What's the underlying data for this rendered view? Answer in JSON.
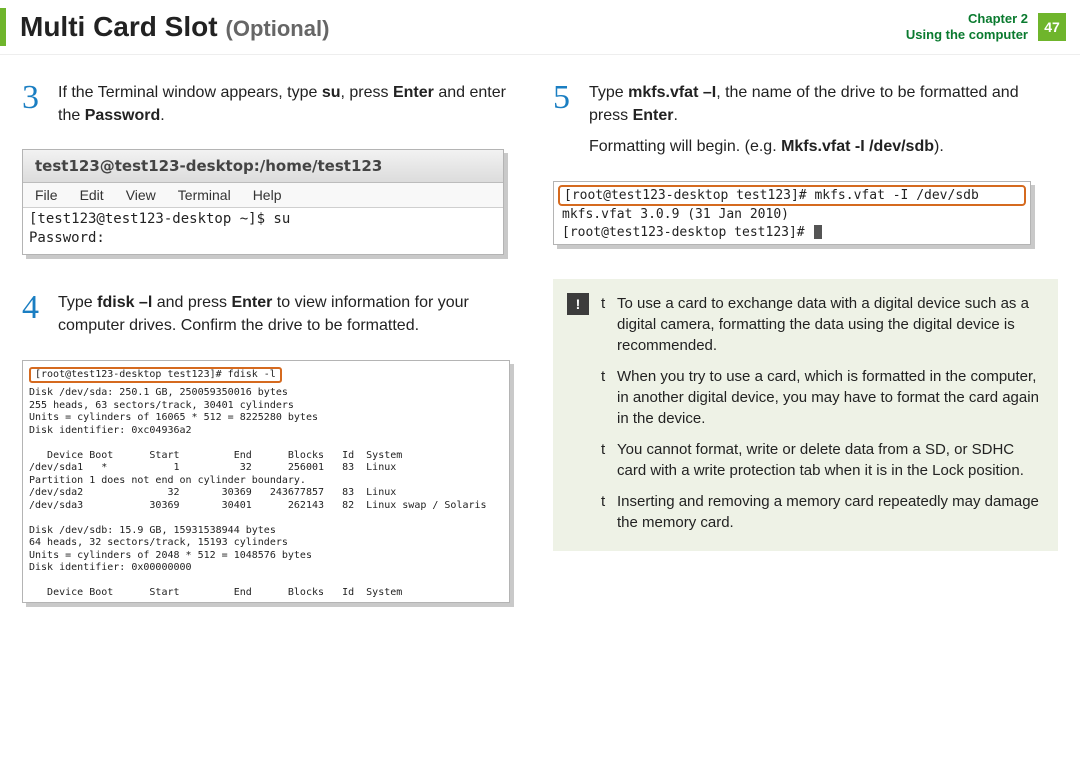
{
  "header": {
    "title_main": "Multi Card Slot",
    "title_sub": "(Optional)",
    "chapter_line1": "Chapter 2",
    "chapter_line2": "Using the computer",
    "page_num": "47"
  },
  "step3": {
    "num": "3",
    "text_parts": [
      "If the Terminal window appears, type ",
      "su",
      ", press ",
      "Enter",
      " and enter the ",
      "Password",
      "."
    ],
    "term_title": "test123@test123-desktop:/home/test123",
    "menu": [
      "File",
      "Edit",
      "View",
      "Terminal",
      "Help"
    ],
    "content": "[test123@test123-desktop ~]$ su\nPassword:"
  },
  "step4": {
    "num": "4",
    "text_parts": [
      "Type ",
      "fdisk –l",
      " and press ",
      "Enter",
      " to view information for your computer drives. Confirm the drive to be formatted."
    ],
    "prompt": "[root@test123-desktop test123]# fdisk -l",
    "body": "Disk /dev/sda: 250.1 GB, 250059350016 bytes\n255 heads, 63 sectors/track, 30401 cylinders\nUnits = cylinders of 16065 * 512 = 8225280 bytes\nDisk identifier: 0xc04936a2\n\n   Device Boot      Start         End      Blocks   Id  System\n/dev/sda1   *           1          32      256001   83  Linux\nPartition 1 does not end on cylinder boundary.\n/dev/sda2              32       30369   243677857   83  Linux\n/dev/sda3           30369       30401      262143   82  Linux swap / Solaris\n\nDisk /dev/sdb: 15.9 GB, 15931538944 bytes\n64 heads, 32 sectors/track, 15193 cylinders\nUnits = cylinders of 2048 * 512 = 1048576 bytes\nDisk identifier: 0x00000000\n\n   Device Boot      Start         End      Blocks   Id  System"
  },
  "step5": {
    "num": "5",
    "text_parts": [
      "Type ",
      "mkfs.vfat –I",
      ", the name of the drive to be formatted and press ",
      "Enter",
      "."
    ],
    "line2_parts": [
      "Formatting will begin. (e.g. ",
      "Mkfs.vfat -I /dev/sdb",
      ")."
    ],
    "line1": "[root@test123-desktop test123]# mkfs.vfat -I /dev/sdb",
    "rest": "mkfs.vfat 3.0.9 (31 Jan 2010)\n[root@test123-desktop test123]# "
  },
  "note": {
    "icon": "!",
    "items": [
      "To use a card to exchange data with a digital device such as a digital camera, formatting the data using the digital device is recommended.",
      "When you try to use a card, which is formatted in the computer, in another digital device, you may have to format the card again in the device.",
      "You cannot format, write or delete data from a SD, or SDHC card with a write protection tab when it is in the Lock position.",
      "Inserting and removing a memory card repeatedly may damage the memory card."
    ],
    "bullet": "t"
  }
}
